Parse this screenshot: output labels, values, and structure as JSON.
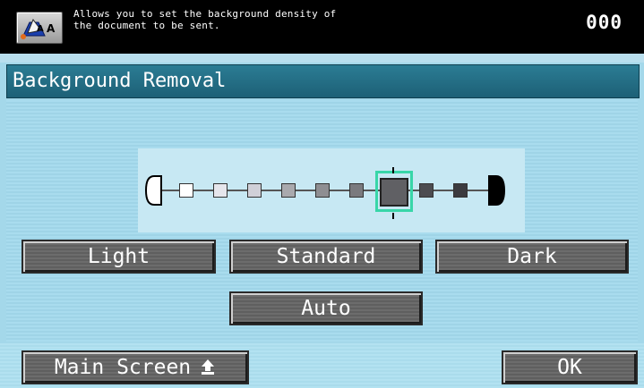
{
  "header": {
    "help_icon": "copy-help-icon",
    "message_line1": "Allows you to set the background density of",
    "message_line2": "the document to be sent.",
    "counter": "000"
  },
  "title": "Background Removal",
  "density_scale": {
    "levels": 9,
    "selected_level": 7,
    "colors": [
      "#ffffff",
      "#e6e6ec",
      "#d0d0d8",
      "#a9a9ad",
      "#8e8e92",
      "#7a7a7e",
      "#606064",
      "#4c4c50",
      "#3b3b3f"
    ]
  },
  "buttons": {
    "light": "Light",
    "standard": "Standard",
    "dark": "Dark",
    "auto": "Auto"
  },
  "footer": {
    "main_screen": "Main Screen",
    "ok": "OK"
  },
  "colors": {
    "selection": "#38d6a8",
    "title_bar": "#246e86",
    "button": "#666666"
  }
}
